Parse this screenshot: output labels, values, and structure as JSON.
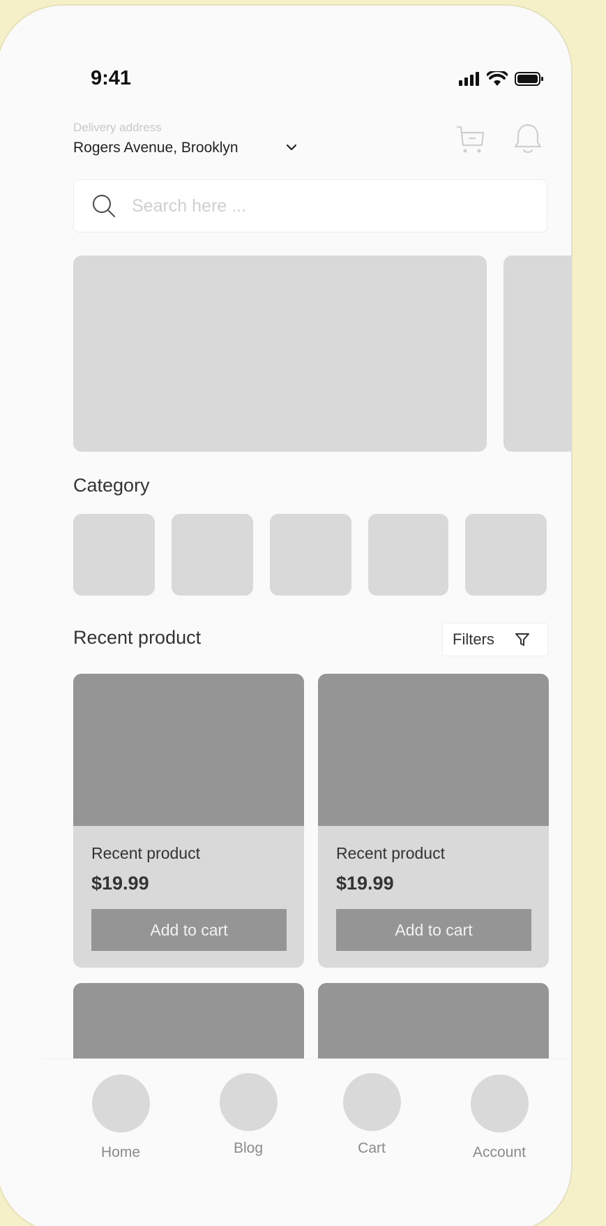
{
  "status_bar": {
    "time": "9:41"
  },
  "header": {
    "delivery_label": "Delivery address",
    "delivery_address": "Rogers Avenue, Brooklyn"
  },
  "search": {
    "placeholder": "Search here ..."
  },
  "category": {
    "title": "Category"
  },
  "recent": {
    "title": "Recent product",
    "filters_label": "Filters",
    "products": [
      {
        "name": "Recent product",
        "price": "$19.99",
        "button": "Add to cart"
      },
      {
        "name": "Recent product",
        "price": "$19.99",
        "button": "Add to cart"
      }
    ]
  },
  "bottom_nav": {
    "items": [
      {
        "label": "Home"
      },
      {
        "label": "Blog"
      },
      {
        "label": "Cart"
      },
      {
        "label": "Account"
      }
    ]
  },
  "colors": {
    "background": "#f5f0c8",
    "placeholder_gray": "#d9d9d9",
    "image_gray": "#959595"
  }
}
